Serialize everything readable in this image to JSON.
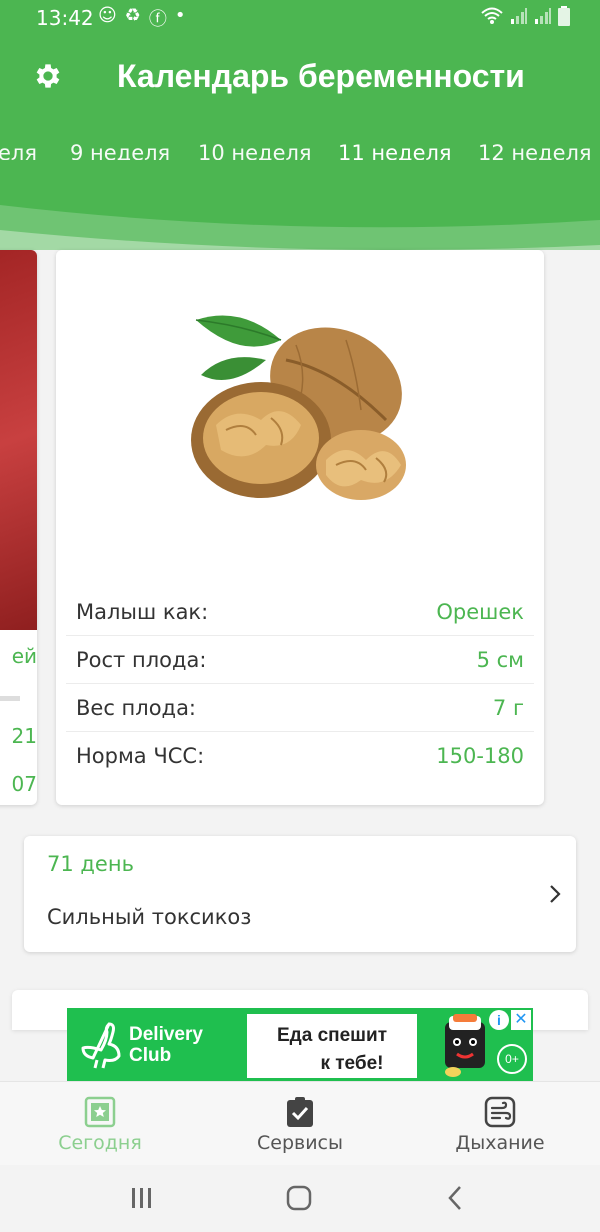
{
  "status": {
    "time": "13:42",
    "icons_left": [
      "baby-icon",
      "recycle-icon",
      "facebook-icon",
      "dot-icon"
    ],
    "icons_right": [
      "wifi-icon",
      "signal-icon",
      "signal-icon",
      "battery-icon"
    ]
  },
  "header": {
    "title": "Календарь беременности",
    "settings_icon": "gear-icon"
  },
  "tabs": [
    {
      "label": "еля"
    },
    {
      "label": "9 неделя"
    },
    {
      "label": "10 неделя"
    },
    {
      "label": "11 неделя",
      "active": true
    },
    {
      "label": "12 неделя"
    }
  ],
  "left_card": {
    "fragments": [
      "ей",
      "21",
      "07"
    ]
  },
  "fruit_card": {
    "image": "walnut",
    "rows": [
      {
        "label": "Малыш как:",
        "value": "Орешек"
      },
      {
        "label": "Рост плода:",
        "value": "5 см"
      },
      {
        "label": "Вес плода:",
        "value": "7 г"
      },
      {
        "label": "Норма ЧСС:",
        "value": "150-180"
      }
    ]
  },
  "day_card": {
    "day": "71 день",
    "text": "Сильный токсикоз"
  },
  "ad": {
    "brand_line1": "Delivery",
    "brand_line2": "Club",
    "text_line1": "Еда спешит",
    "text_line2": "к тебе!",
    "info": "i",
    "close": "✕",
    "age": "0+"
  },
  "nav": [
    {
      "label": "Сегодня",
      "icon": "star-card-icon",
      "active": true
    },
    {
      "label": "Сервисы",
      "icon": "clipboard-check-icon"
    },
    {
      "label": "Дыхание",
      "icon": "breath-icon"
    }
  ],
  "colors": {
    "primary": "#4cb651",
    "accent_light": "#8ccf8f",
    "ad_green": "#1fbf4f"
  }
}
